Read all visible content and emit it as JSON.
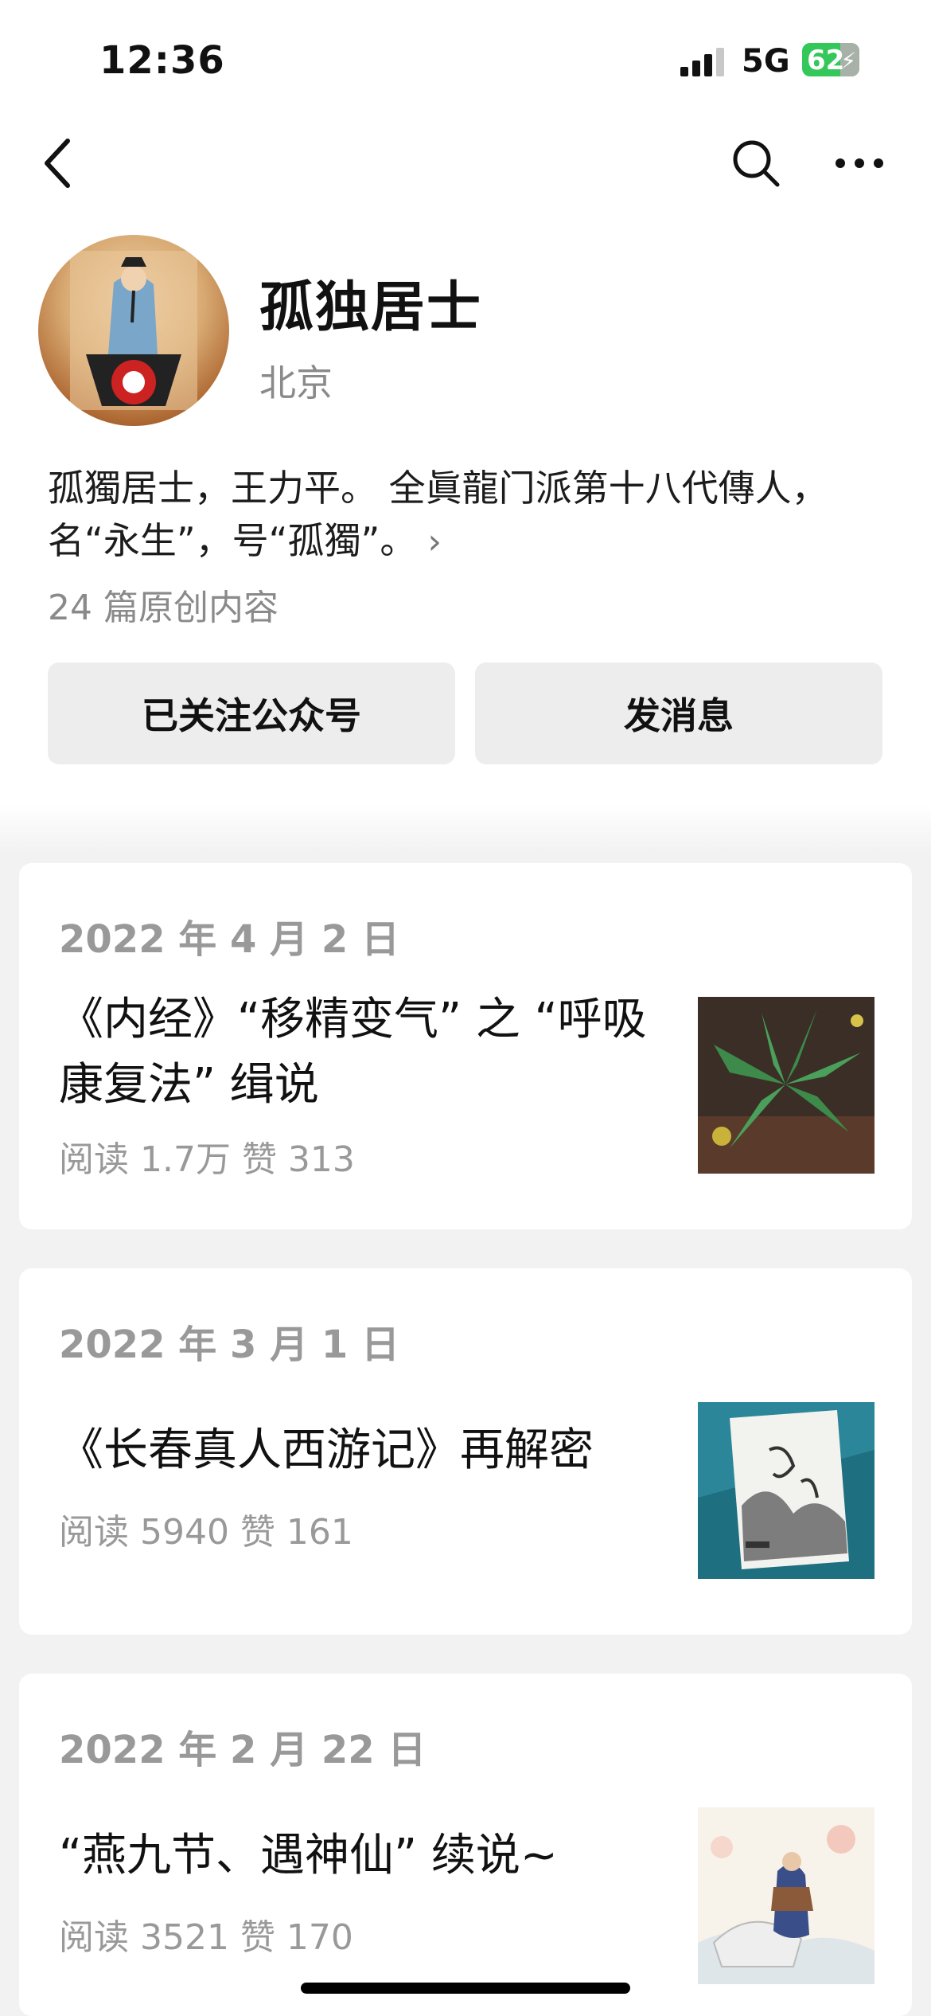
{
  "status_bar": {
    "time": "12:36",
    "network": "5G",
    "battery": "62"
  },
  "profile": {
    "name": "孤独居士",
    "location": "北京",
    "description": "孤獨居士，王力平。 全眞龍门派第十八代傳人，名“永生”，号“孤獨”。",
    "original_count": "24 篇原创内容"
  },
  "actions": {
    "follow_label": "已关注公众号",
    "message_label": "发消息"
  },
  "articles": [
    {
      "date": "2022 年 4 月 2 日",
      "title": "《内经》“移精变气” 之 “呼吸康复法” 缉说",
      "meta": "阅读 1.7万  赞 313"
    },
    {
      "date": "2022 年 3 月 1 日",
      "title": "《长春真人西游记》再解密",
      "meta": "阅读 5940  赞 161"
    },
    {
      "date": "2022 年 2 月 22 日",
      "title": "“燕九节、遇神仙” 续说~",
      "meta": "阅读 3521  赞 170"
    }
  ]
}
